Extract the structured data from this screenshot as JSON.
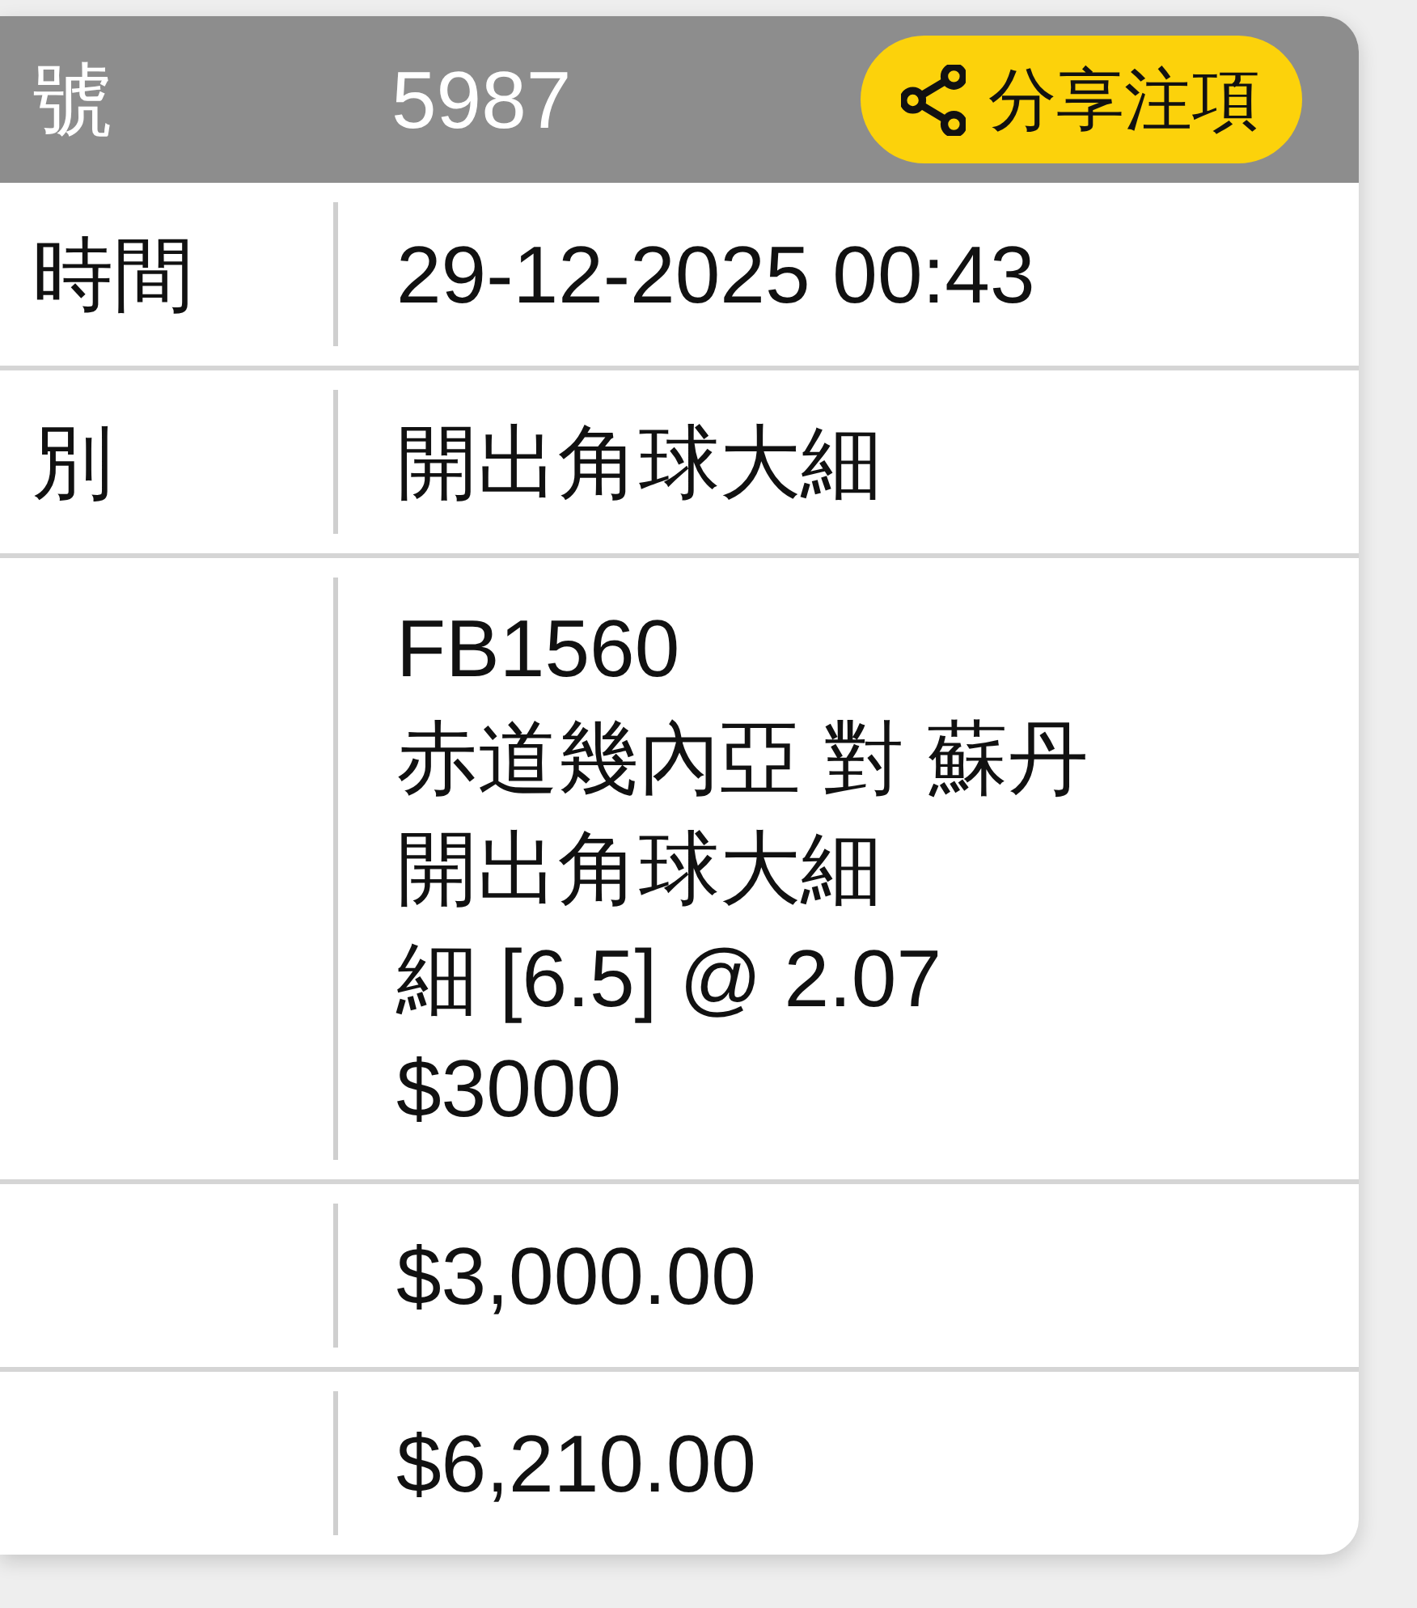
{
  "header": {
    "label": "號",
    "value": "5987",
    "share_button": {
      "label": "分享注項"
    }
  },
  "rows": [
    {
      "label": "時間",
      "lines": [
        "29-12-2025 00:43"
      ]
    },
    {
      "label": "別",
      "lines": [
        "開出角球大細"
      ]
    },
    {
      "lines": [
        "FB1560",
        "赤道幾內亞 對 蘇丹",
        "開出角球大細",
        "細 [6.5] @ 2.07",
        "$3000"
      ]
    },
    {
      "lines": [
        "$3,000.00"
      ]
    },
    {
      "lines": [
        "$6,210.00"
      ]
    }
  ]
}
